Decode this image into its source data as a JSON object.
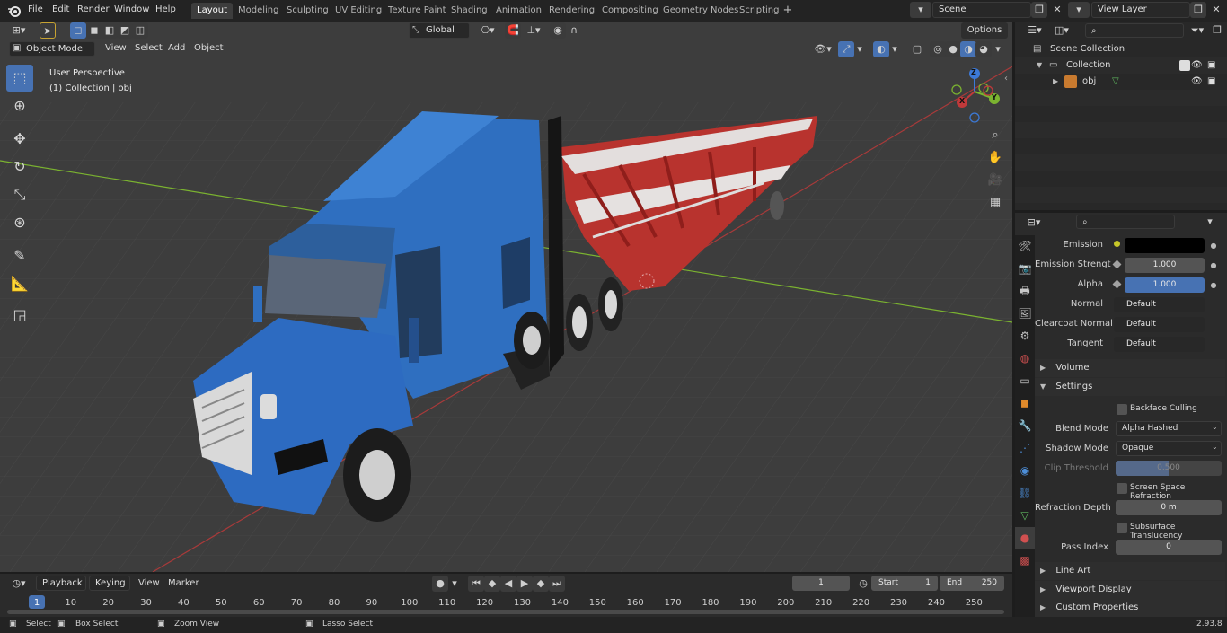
{
  "topbar": {
    "menus": [
      "File",
      "Edit",
      "Render",
      "Window",
      "Help"
    ],
    "workspaces": [
      "Layout",
      "Modeling",
      "Sculpting",
      "UV Editing",
      "Texture Paint",
      "Shading",
      "Animation",
      "Rendering",
      "Compositing",
      "Geometry Nodes",
      "Scripting"
    ],
    "active_workspace": "Layout",
    "add_tab": "+",
    "scene_name": "Scene",
    "view_layer": "View Layer"
  },
  "viewport_header": {
    "mode": "Object Mode",
    "menus": [
      "View",
      "Select",
      "Add",
      "Object"
    ],
    "transform_orientation": "Global",
    "options_label": "Options"
  },
  "viewport": {
    "perspective_label": "User Perspective",
    "collection_label": "(1) Collection | obj",
    "gizmo_axes": [
      "Z",
      "Y",
      "X"
    ]
  },
  "outliner": {
    "items": [
      {
        "label": "Scene Collection"
      },
      {
        "label": "Collection"
      },
      {
        "label": "obj"
      }
    ]
  },
  "properties": {
    "rows": [
      {
        "label": "Emission",
        "value": ""
      },
      {
        "label": "Emission Strengt",
        "value": "1.000"
      },
      {
        "label": "Alpha",
        "value": "1.000"
      },
      {
        "label": "Normal",
        "value": "Default"
      },
      {
        "label": "Clearcoat Normal",
        "value": "Default"
      },
      {
        "label": "Tangent",
        "value": "Default"
      }
    ],
    "panels": {
      "volume": "Volume",
      "settings": "Settings",
      "line_art": "Line Art",
      "viewport_display": "Viewport Display",
      "custom_properties": "Custom Properties"
    },
    "settings": {
      "backface_culling": "Backface Culling",
      "blend_mode_label": "Blend Mode",
      "blend_mode_value": "Alpha Hashed",
      "shadow_mode_label": "Shadow Mode",
      "shadow_mode_value": "Opaque",
      "clip_threshold_label": "Clip Threshold",
      "clip_threshold_value": "0.500",
      "screen_space_refraction": "Screen Space Refraction",
      "refraction_depth_label": "Refraction Depth",
      "refraction_depth_value": "0 m",
      "subsurface_translucency": "Subsurface Translucency",
      "pass_index_label": "Pass Index",
      "pass_index_value": "0"
    }
  },
  "timeline": {
    "menus": [
      "Playback",
      "Keying",
      "View",
      "Marker"
    ],
    "current_frame": "1",
    "start_label": "Start",
    "start_value": "1",
    "end_label": "End",
    "end_value": "250",
    "ticks": [
      "1",
      "10",
      "20",
      "30",
      "40",
      "50",
      "60",
      "70",
      "80",
      "90",
      "100",
      "110",
      "120",
      "130",
      "140",
      "150",
      "160",
      "170",
      "180",
      "190",
      "200",
      "210",
      "220",
      "230",
      "240",
      "250"
    ]
  },
  "statusbar": {
    "select": "Select",
    "box_select": "Box Select",
    "zoom_view": "Zoom View",
    "lasso_select": "Lasso Select",
    "version": "2.93.8"
  },
  "colors": {
    "accent_blue": "#4772b3",
    "truck_blue": "#2f6fc0",
    "trailer_red": "#c8322c",
    "x_axis": "#c0393a",
    "y_axis": "#7bb330",
    "z_axis": "#3c79d6"
  }
}
